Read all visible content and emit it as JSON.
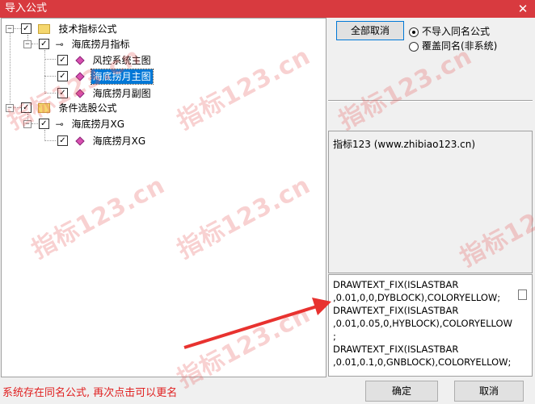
{
  "window": {
    "title": "导入公式",
    "close_glyph": "✕"
  },
  "tree": {
    "root1": {
      "label": "技术指标公式",
      "expand": "−",
      "check": "✓"
    },
    "group1": {
      "label": "海底捞月指标",
      "expand": "−",
      "check": "✓"
    },
    "items1": [
      {
        "label": "风控系统主图",
        "check": "✓"
      },
      {
        "label": "海底捞月主图",
        "check": "✓"
      },
      {
        "label": "海底捞月副图",
        "check": "✓"
      }
    ],
    "root2": {
      "label": "条件选股公式",
      "expand": "−",
      "check": "✓"
    },
    "group2": {
      "label": "海底捞月XG",
      "expand": "−",
      "check": "✓"
    },
    "items2": [
      {
        "label": "海底捞月XG",
        "check": "✓"
      }
    ]
  },
  "buttons": {
    "cancel_all": "全部取消",
    "ok": "确定",
    "cancel": "取消"
  },
  "options": {
    "no_import_same": "不导入同名公式",
    "overwrite_same": "覆盖同名(非系统)"
  },
  "info": {
    "text": "指标123   (www.zhibiao123.cn)"
  },
  "code": {
    "text": "DRAWTEXT_FIX(ISLASTBAR\n,0.01,0,0,DYBLOCK),COLORYELLOW;\nDRAWTEXT_FIX(ISLASTBAR\n,0.01,0.05,0,HYBLOCK),COLORYELLOW\n;\nDRAWTEXT_FIX(ISLASTBAR\n,0.01,0.1,0,GNBLOCK),COLORYELLOW;"
  },
  "status": {
    "text": "系统存在同名公式, 再次点击可以更名"
  },
  "watermark": {
    "text": "指标123.cn"
  },
  "colors": {
    "titlebar": "#d83a3f",
    "selection": "#0078d7",
    "status": "#e02020",
    "arrow": "#e8322f"
  }
}
